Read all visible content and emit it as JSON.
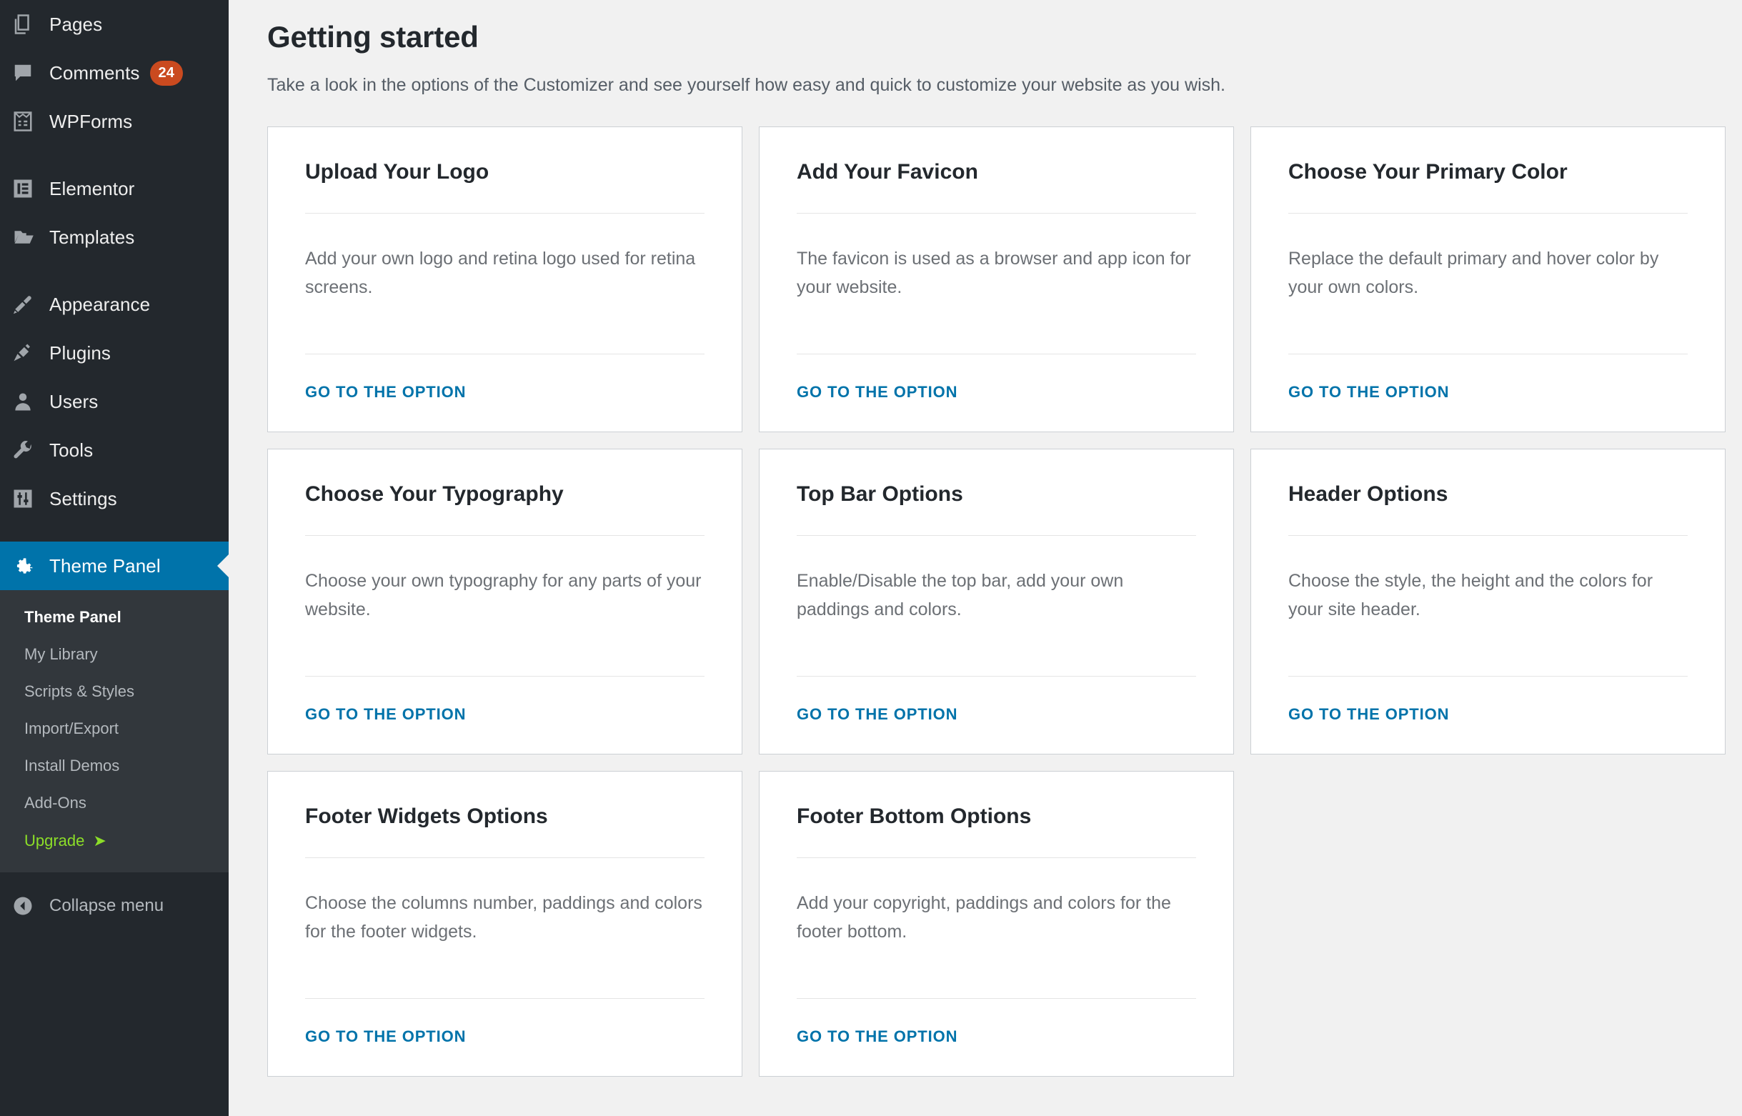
{
  "theme": {
    "accent_blue": "#0073aa",
    "sidebar_bg": "#23282d",
    "submenu_bg": "#32373c",
    "content_bg": "#f1f1f1",
    "badge_color": "#ca4a1f",
    "upgrade_color": "#8cde28",
    "card_border": "#ccd0d4"
  },
  "sidebar": {
    "items": [
      {
        "label": "Pages",
        "icon": "pages-icon",
        "badge": null,
        "active": false
      },
      {
        "label": "Comments",
        "icon": "comments-icon",
        "badge": "24",
        "active": false
      },
      {
        "label": "WPForms",
        "icon": "wpforms-icon",
        "badge": null,
        "active": false
      },
      {
        "label": "Elementor",
        "icon": "elementor-icon",
        "badge": null,
        "active": false
      },
      {
        "label": "Templates",
        "icon": "folder-icon",
        "badge": null,
        "active": false
      },
      {
        "label": "Appearance",
        "icon": "paintbrush-icon",
        "badge": null,
        "active": false
      },
      {
        "label": "Plugins",
        "icon": "plug-icon",
        "badge": null,
        "active": false
      },
      {
        "label": "Users",
        "icon": "user-icon",
        "badge": null,
        "active": false
      },
      {
        "label": "Tools",
        "icon": "wrench-icon",
        "badge": null,
        "active": false
      },
      {
        "label": "Settings",
        "icon": "sliders-icon",
        "badge": null,
        "active": false
      },
      {
        "label": "Theme Panel",
        "icon": "gear-icon",
        "badge": null,
        "active": true
      }
    ],
    "submenu": [
      {
        "label": "Theme Panel",
        "current": true,
        "upgrade": false
      },
      {
        "label": "My Library",
        "current": false,
        "upgrade": false
      },
      {
        "label": "Scripts & Styles",
        "current": false,
        "upgrade": false
      },
      {
        "label": "Import/Export",
        "current": false,
        "upgrade": false
      },
      {
        "label": "Install Demos",
        "current": false,
        "upgrade": false
      },
      {
        "label": "Add-Ons",
        "current": false,
        "upgrade": false
      },
      {
        "label": "Upgrade",
        "current": false,
        "upgrade": true,
        "arrow": "➤"
      }
    ],
    "collapse": {
      "label": "Collapse menu",
      "icon": "collapse-left-icon"
    }
  },
  "main": {
    "title": "Getting started",
    "subtitle": "Take a look in the options of the Customizer and see yourself how easy and quick to customize your website as you wish.",
    "cards": [
      {
        "title": "Upload Your Logo",
        "body": "Add your own logo and retina logo used for retina screens.",
        "link": "GO TO THE OPTION"
      },
      {
        "title": "Add Your Favicon",
        "body": "The favicon is used as a browser and app icon for your website.",
        "link": "GO TO THE OPTION"
      },
      {
        "title": "Choose Your Primary Color",
        "body": "Replace the default primary and hover color by your own colors.",
        "link": "GO TO THE OPTION"
      },
      {
        "title": "Choose Your Typography",
        "body": "Choose your own typography for any parts of your website.",
        "link": "GO TO THE OPTION"
      },
      {
        "title": "Top Bar Options",
        "body": "Enable/Disable the top bar, add your own paddings and colors.",
        "link": "GO TO THE OPTION"
      },
      {
        "title": "Header Options",
        "body": "Choose the style, the height and the colors for your site header.",
        "link": "GO TO THE OPTION"
      },
      {
        "title": "Footer Widgets Options",
        "body": "Choose the columns number, paddings and colors for the footer widgets.",
        "link": "GO TO THE OPTION"
      },
      {
        "title": "Footer Bottom Options",
        "body": "Add your copyright, paddings and colors for the footer bottom.",
        "link": "GO TO THE OPTION"
      }
    ]
  }
}
